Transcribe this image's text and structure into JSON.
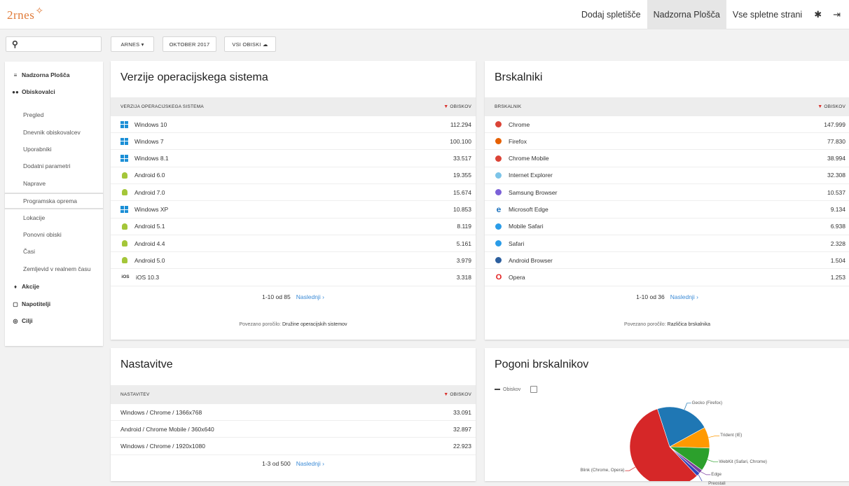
{
  "brand": {
    "logo_text": "2rnes"
  },
  "topnav": {
    "items": [
      "Dodaj spletišče",
      "Nadzorna Plošča",
      "Vse spletne strani"
    ],
    "active_index": 1,
    "settings_icon": "gear-icon",
    "logout_icon": "logout-icon"
  },
  "search": {
    "icon": "search-icon",
    "value": ""
  },
  "filters": {
    "site": "ARNES ▾",
    "period": "OKTOBER 2017",
    "segment": "VSI OBISKI ☁"
  },
  "sidebar": {
    "main1": "Nadzorna Plošča",
    "main2": "Obiskovalci",
    "subs": [
      "Pregled",
      "Dnevnik obiskovalcev",
      "Uporabniki",
      "Dodatni parametri",
      "Naprave",
      "Programska oprema",
      "Lokacije",
      "Ponovni obiski",
      "Časi",
      "Zemljevid v realnem času"
    ],
    "selected_sub_index": 5,
    "main3": "Akcije",
    "main4": "Napotitelji",
    "main5": "Cilji"
  },
  "os_card": {
    "title": "Verzije operacijskega sistema",
    "col1": "VERZIJA OPERACIJSKEGA SISTEMA",
    "col2": "OBISKOV",
    "rows": [
      {
        "name": "Windows 10",
        "value": "112.294",
        "icon": "windows"
      },
      {
        "name": "Windows 7",
        "value": "100.100",
        "icon": "windows"
      },
      {
        "name": "Windows 8.1",
        "value": "33.517",
        "icon": "windows"
      },
      {
        "name": "Android 6.0",
        "value": "19.355",
        "icon": "android"
      },
      {
        "name": "Android 7.0",
        "value": "15.674",
        "icon": "android"
      },
      {
        "name": "Windows XP",
        "value": "10.853",
        "icon": "windows"
      },
      {
        "name": "Android 5.1",
        "value": "8.119",
        "icon": "android"
      },
      {
        "name": "Android 4.4",
        "value": "5.161",
        "icon": "android"
      },
      {
        "name": "Android 5.0",
        "value": "3.979",
        "icon": "android"
      },
      {
        "name": "iOS 10.3",
        "value": "3.318",
        "icon": "ios"
      }
    ],
    "pager": "1-10 od 85",
    "next": "Naslednji ›",
    "related_prefix": "Povezano poročilo:",
    "related_link": "Družine operacijskih sistemov"
  },
  "browser_card": {
    "title": "Brskalniki",
    "col1": "BRSKALNIK",
    "col2": "OBISKOV",
    "rows": [
      {
        "name": "Chrome",
        "value": "147.999",
        "color": "#db4437"
      },
      {
        "name": "Firefox",
        "value": "77.830",
        "color": "#e66000"
      },
      {
        "name": "Chrome Mobile",
        "value": "38.994",
        "color": "#db4437"
      },
      {
        "name": "Internet Explorer",
        "value": "32.308",
        "color": "#7cc4e8"
      },
      {
        "name": "Samsung Browser",
        "value": "10.537",
        "color": "#7b61d8"
      },
      {
        "name": "Microsoft Edge",
        "value": "9.134",
        "color": "#1e73be"
      },
      {
        "name": "Mobile Safari",
        "value": "6.938",
        "color": "#2a9ce8"
      },
      {
        "name": "Safari",
        "value": "2.328",
        "color": "#2a9ce8"
      },
      {
        "name": "Android Browser",
        "value": "1.504",
        "color": "#2d5f9e"
      },
      {
        "name": "Opera",
        "value": "1.253",
        "color": "#e21a1a"
      }
    ],
    "pager": "1-10 od 36",
    "next": "Naslednji ›",
    "related_prefix": "Povezano poročilo:",
    "related_link": "Različica brskalnika"
  },
  "settings_card": {
    "title": "Nastavitve",
    "col1": "NASTAVITEV",
    "col2": "OBISKOV",
    "rows": [
      {
        "name": "Windows / Chrome / 1366x768",
        "value": "33.091"
      },
      {
        "name": "Android / Chrome Mobile / 360x640",
        "value": "32.897"
      },
      {
        "name": "Windows / Chrome / 1920x1080",
        "value": "22.923"
      }
    ],
    "pager": "1-3 od 500",
    "next": "Naslednji ›"
  },
  "engines_card": {
    "title": "Pogoni brskalnikov",
    "legend": "Obiskov",
    "chart_data": {
      "type": "pie",
      "title": "Pogoni brskalnikov",
      "series": [
        {
          "name": "Obiskov",
          "values": [
            22,
            8.5,
            9.5,
            1.5,
            1.5,
            57
          ]
        }
      ],
      "categories": [
        "Gecko (Firefox)",
        "Trident (IE)",
        "WebKit (Safari, Chrome)",
        "Edge",
        "Preostali",
        "Blink (Chrome, Opera)"
      ],
      "colors": [
        "#1f77b4",
        "#ff9900",
        "#2ca02c",
        "#7b3fa0",
        "#3344bb",
        "#d62728"
      ]
    }
  }
}
